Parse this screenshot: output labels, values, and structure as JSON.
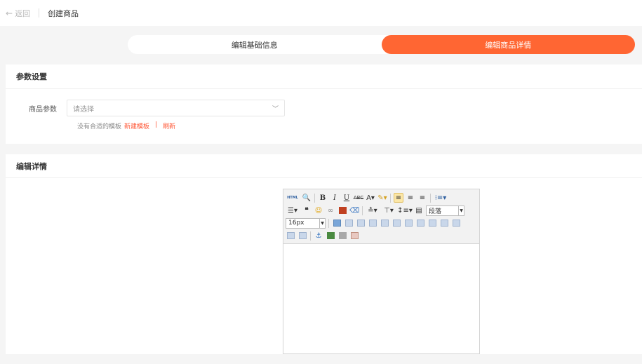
{
  "header": {
    "back_label": "返回",
    "title": "创建商品"
  },
  "steps": [
    {
      "label": "编辑基础信息",
      "active": false
    },
    {
      "label": "编辑商品详情",
      "active": true
    }
  ],
  "params_section": {
    "title": "参数设置",
    "field_label": "商品参数",
    "select_placeholder": "请选择",
    "hint_text": "没有合适的模板",
    "new_template_link": "新建模板",
    "separator": "|",
    "refresh_link": "刷新"
  },
  "detail_section": {
    "title": "编辑详情"
  },
  "editor": {
    "html_label": "HTML",
    "paragraph_select": "段落",
    "font_size_select": "16px"
  },
  "colors": {
    "accent": "#ff6633",
    "link": "#ff5533"
  }
}
